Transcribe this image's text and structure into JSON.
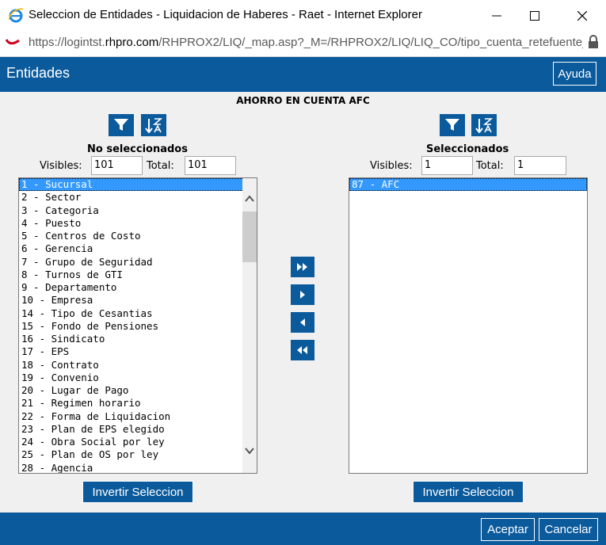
{
  "window": {
    "title": "Seleccion de Entidades - Liquidacion de Haberes - Raet - Internet Explorer",
    "url_prefix": "https://logintst.",
    "url_domain": "rhpro.com",
    "url_path": "/RHPROX2/LIQ/_map.asp?_M=/RHPROX2/LIQ/LIQ_CO/tipo_cuenta_retefuente_e"
  },
  "header": {
    "title": "Entidades",
    "help_label": "Ayuda"
  },
  "section_title": "AHORRO EN CUENTA AFC",
  "left": {
    "label": "No seleccionados",
    "visibles_label": "Visibles:",
    "visibles_value": "101",
    "total_label": "Total:",
    "total_value": "101",
    "items": [
      "1 - Sucursal",
      "2 - Sector",
      "3 - Categoria",
      "4 - Puesto",
      "5 - Centros de Costo",
      "6 - Gerencia",
      "7 - Grupo de Seguridad",
      "8 - Turnos de GTI",
      "9 - Departamento",
      "10 - Empresa",
      "14 - Tipo de Cesantias",
      "15 - Fondo de Pensiones",
      "16 - Sindicato",
      "17 - EPS",
      "18 - Contrato",
      "19 - Convenio",
      "20 - Lugar de Pago",
      "21 - Regimen horario",
      "22 - Forma de Liquidacion",
      "23 - Plan de EPS elegido",
      "24 - Obra Social por ley",
      "25 - Plan de OS por ley",
      "28 - Agencia"
    ],
    "invert_label": "Invertir Seleccion"
  },
  "right": {
    "label": "Seleccionados",
    "visibles_label": "Visibles:",
    "visibles_value": "1",
    "total_label": "Total:",
    "total_value": "1",
    "items": [
      "87 - AFC"
    ],
    "invert_label": "Invertir Seleccion"
  },
  "footer": {
    "accept_label": "Aceptar",
    "cancel_label": "Cancelar"
  },
  "icons": {
    "filter": "filter-icon",
    "sort": "sort-za-icon",
    "move_all_right": "double-chevron-right-icon",
    "move_right": "chevron-right-icon",
    "move_left": "chevron-left-icon",
    "move_all_left": "double-chevron-left-icon"
  },
  "colors": {
    "brand_blue": "#0a5a9c",
    "selection": "#3399ff",
    "panel_bg": "#f0f0f0"
  }
}
